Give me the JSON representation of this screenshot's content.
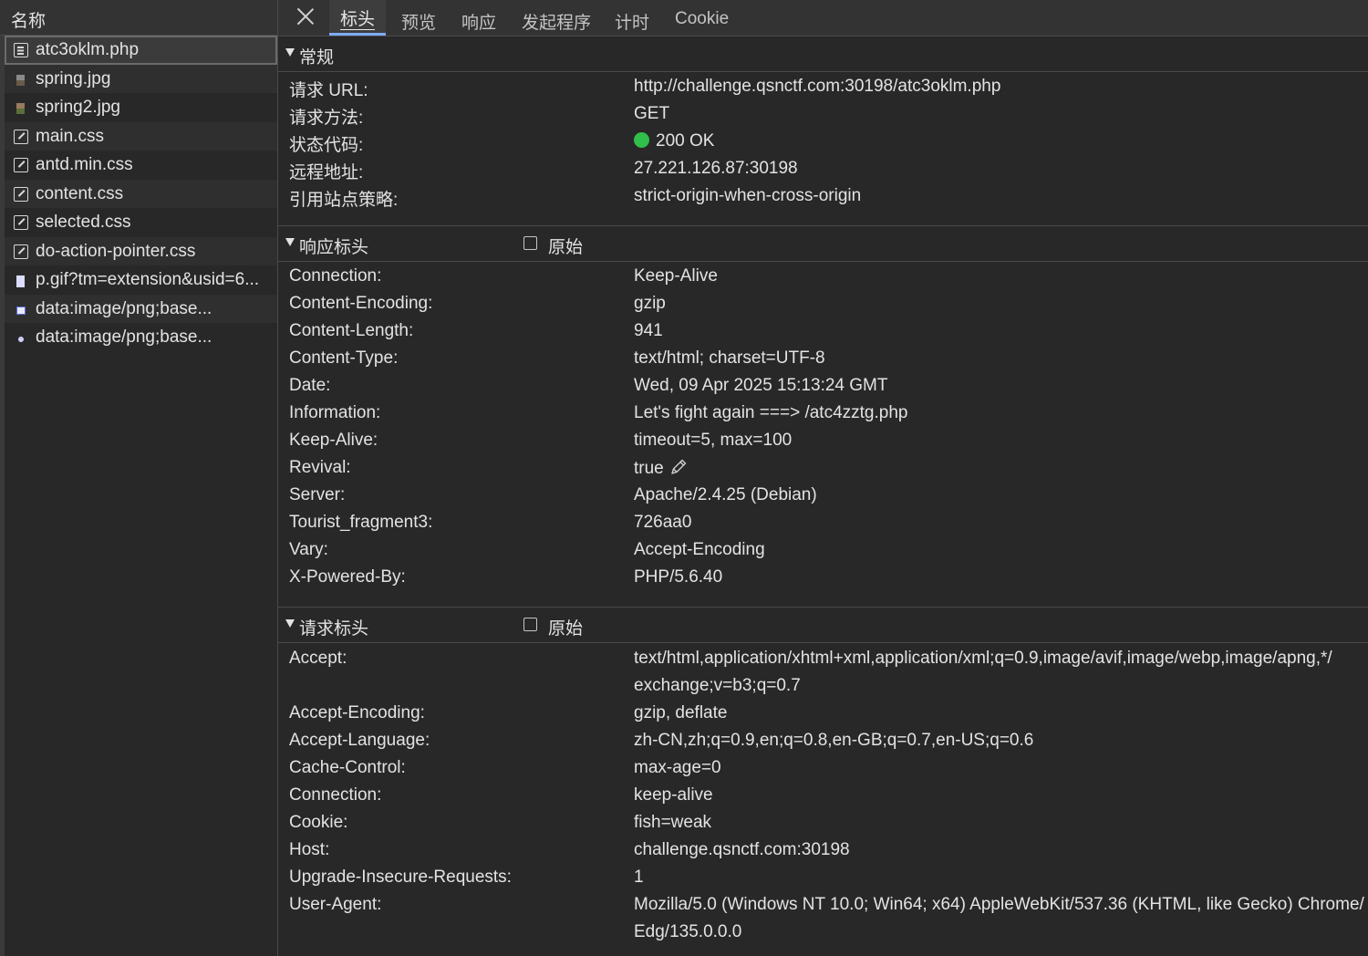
{
  "file_panel": {
    "header": "名称",
    "files": [
      {
        "name": "atc3oklm.php",
        "icon": "document-icon"
      },
      {
        "name": "spring.jpg",
        "icon": "image-icon"
      },
      {
        "name": "spring2.jpg",
        "icon": "image-icon"
      },
      {
        "name": "main.css",
        "icon": "stylesheet-icon"
      },
      {
        "name": "antd.min.css",
        "icon": "stylesheet-icon"
      },
      {
        "name": "content.css",
        "icon": "stylesheet-icon"
      },
      {
        "name": "selected.css",
        "icon": "stylesheet-icon"
      },
      {
        "name": "do-action-pointer.css",
        "icon": "stylesheet-icon"
      },
      {
        "name": "p.gif?tm=extension&usid=6...",
        "icon": "image-icon"
      },
      {
        "name": "data:image/png;base...",
        "icon": "image-icon"
      },
      {
        "name": "data:image/png;base...",
        "icon": "image-icon"
      }
    ]
  },
  "tabs": [
    "标头",
    "预览",
    "响应",
    "发起程序",
    "计时",
    "Cookie"
  ],
  "general": {
    "title": "常规",
    "rows": [
      {
        "k": "请求 URL:",
        "v": "http://challenge.qsnctf.com:30198/atc3oklm.php"
      },
      {
        "k": "请求方法:",
        "v": "GET"
      },
      {
        "k": "状态代码:",
        "v": "200 OK"
      },
      {
        "k": "远程地址:",
        "v": "27.221.126.87:30198"
      },
      {
        "k": "引用站点策略:",
        "v": "strict-origin-when-cross-origin"
      }
    ]
  },
  "response_headers": {
    "title": "响应标头",
    "raw_label": "原始",
    "rows": [
      {
        "k": "Connection:",
        "v": "Keep-Alive"
      },
      {
        "k": "Content-Encoding:",
        "v": "gzip"
      },
      {
        "k": "Content-Length:",
        "v": "941"
      },
      {
        "k": "Content-Type:",
        "v": "text/html; charset=UTF-8"
      },
      {
        "k": "Date:",
        "v": "Wed, 09 Apr 2025 15:13:24 GMT"
      },
      {
        "k": "Information:",
        "v": "Let's fight again ===> /atc4zztg.php"
      },
      {
        "k": "Keep-Alive:",
        "v": "timeout=5, max=100"
      },
      {
        "k": "Revival:",
        "v": "true"
      },
      {
        "k": "Server:",
        "v": "Apache/2.4.25 (Debian)"
      },
      {
        "k": "Tourist_fragment3:",
        "v": "726aa0"
      },
      {
        "k": "Vary:",
        "v": "Accept-Encoding"
      },
      {
        "k": "X-Powered-By:",
        "v": "PHP/5.6.40"
      }
    ]
  },
  "request_headers": {
    "title": "请求标头",
    "raw_label": "原始",
    "rows": [
      {
        "k": "Accept:",
        "v": "text/html,application/xhtml+xml,application/xml;q=0.9,image/avif,image/webp,image/apng,*/",
        "v2": "exchange;v=b3;q=0.7"
      },
      {
        "k": "Accept-Encoding:",
        "v": "gzip, deflate"
      },
      {
        "k": "Accept-Language:",
        "v": "zh-CN,zh;q=0.9,en;q=0.8,en-GB;q=0.7,en-US;q=0.6"
      },
      {
        "k": "Cache-Control:",
        "v": "max-age=0"
      },
      {
        "k": "Connection:",
        "v": "keep-alive"
      },
      {
        "k": "Cookie:",
        "v": "fish=weak"
      },
      {
        "k": "Host:",
        "v": "challenge.qsnctf.com:30198"
      },
      {
        "k": "Upgrade-Insecure-Requests:",
        "v": "1"
      },
      {
        "k": "User-Agent:",
        "v": "Mozilla/5.0 (Windows NT 10.0; Win64; x64) AppleWebKit/537.36 (KHTML, like Gecko) Chrome/",
        "v2": "Edg/135.0.0.0"
      }
    ]
  },
  "colors": {
    "status_ok": "#2fbf4a",
    "active_tab_underline": "#7cacf8"
  }
}
